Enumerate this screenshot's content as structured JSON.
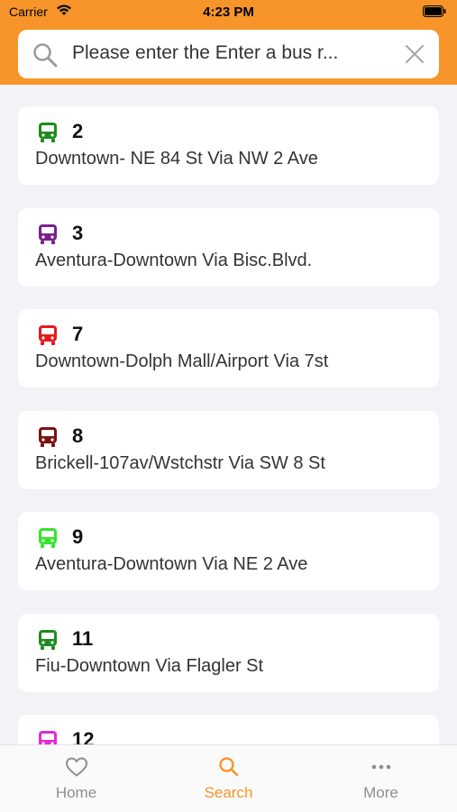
{
  "status_bar": {
    "carrier": "Carrier",
    "time": "4:23 PM"
  },
  "search": {
    "value": "Please enter the Enter a bus r..."
  },
  "routes": [
    {
      "number": "2",
      "name": "Downtown- NE 84 St Via NW 2 Ave",
      "color": "#1f8a1f"
    },
    {
      "number": "3",
      "name": "Aventura-Downtown Via Bisc.Blvd.",
      "color": "#7a1f8a"
    },
    {
      "number": "7",
      "name": "Downtown-Dolph Mall/Airport Via 7st",
      "color": "#e8191a"
    },
    {
      "number": "8",
      "name": "Brickell-107av/Wstchstr Via SW 8 St",
      "color": "#7a1212"
    },
    {
      "number": "9",
      "name": "Aventura-Downtown Via NE 2 Ave",
      "color": "#33e62c"
    },
    {
      "number": "11",
      "name": "Fiu-Downtown Via Flagler St",
      "color": "#1f8a1f"
    },
    {
      "number": "12",
      "name": "",
      "color": "#e42ad6"
    }
  ],
  "tabs": [
    {
      "label": "Home",
      "icon": "heart-icon",
      "active": false
    },
    {
      "label": "Search",
      "icon": "search-icon",
      "active": true
    },
    {
      "label": "More",
      "icon": "more-icon",
      "active": false
    }
  ],
  "colors": {
    "accent": "#f7952a",
    "background": "#f2f2f7"
  }
}
